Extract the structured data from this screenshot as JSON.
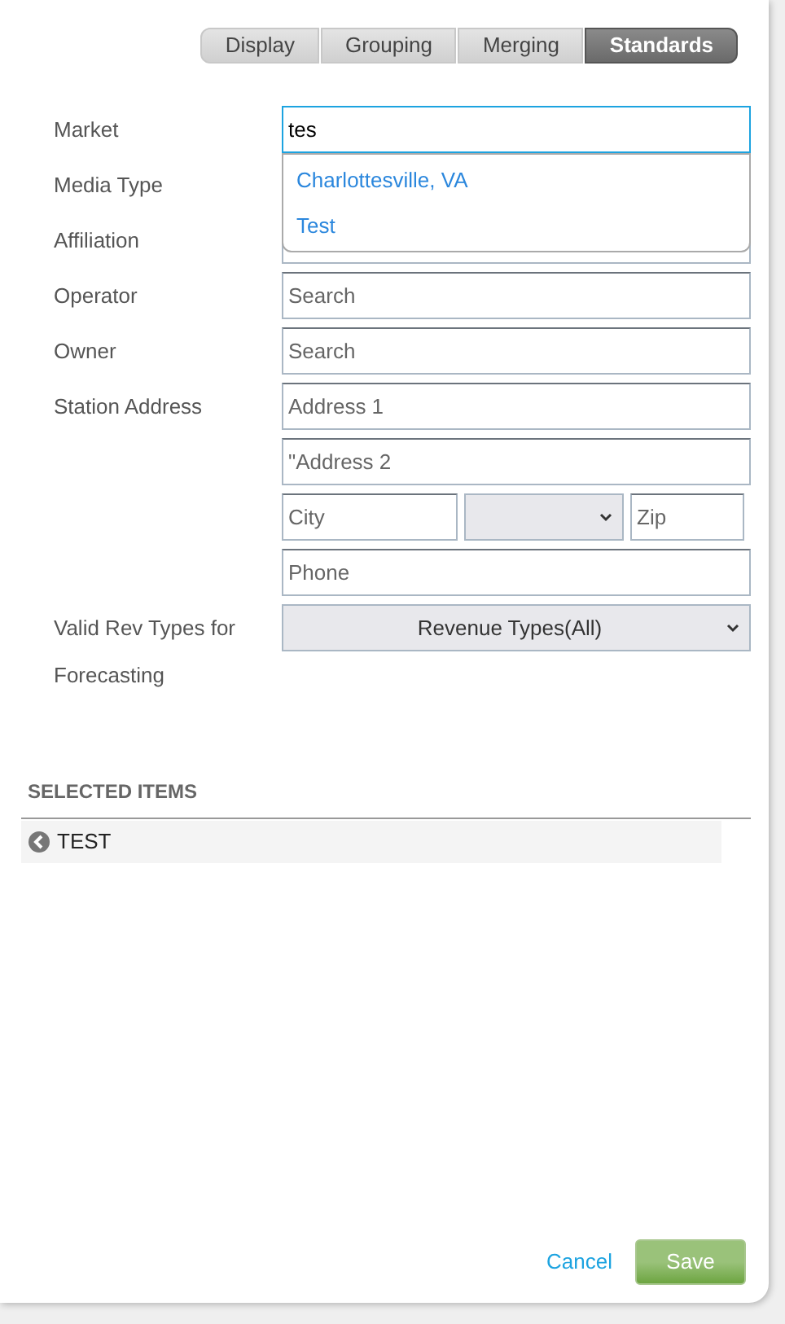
{
  "tabs": [
    {
      "label": "Display",
      "selected": false
    },
    {
      "label": "Grouping",
      "selected": false
    },
    {
      "label": "Merging",
      "selected": false
    },
    {
      "label": "Standards",
      "selected": true
    }
  ],
  "form": [
    {
      "label": "Market",
      "kind": "text",
      "value": "tes",
      "focused": true
    },
    {
      "label": "Media Type",
      "kind": "hidden"
    },
    {
      "label": "Affiliation",
      "kind": "covered"
    },
    {
      "label": "Operator",
      "kind": "text",
      "placeholder": "Search"
    },
    {
      "label": "Owner",
      "kind": "text",
      "placeholder": "Search"
    },
    {
      "label": "Station Address",
      "kind": "text",
      "placeholder": "Address 1"
    },
    {
      "kind": "text",
      "placeholder": "\"Address 2"
    },
    {
      "kind": "city",
      "city_placeholder": "City",
      "zip_placeholder": "Zip"
    },
    {
      "kind": "text",
      "placeholder": "Phone"
    },
    {
      "label": "Valid Rev Types for Forecasting",
      "kind": "select",
      "value": "Revenue Types(All)"
    }
  ],
  "suggestions": [
    {
      "label": "Charlottesville, VA"
    },
    {
      "label": "Test"
    }
  ],
  "selected_items": {
    "title": "SELECTED ITEMS",
    "items": [
      {
        "label": "TEST"
      }
    ]
  },
  "footer": {
    "cancel": "Cancel",
    "save": "Save"
  }
}
